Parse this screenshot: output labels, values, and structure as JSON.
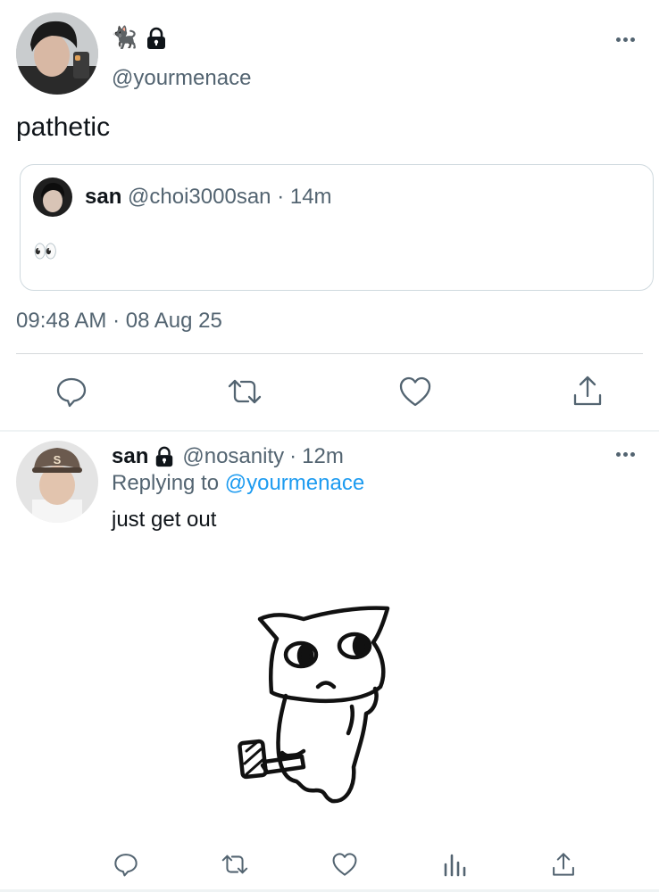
{
  "main_tweet": {
    "name_emoji": "🐈‍⬛",
    "handle": "@yourmenace",
    "text": "pathetic",
    "timestamp": "09:48 AM · 08 Aug 25"
  },
  "quoted_tweet": {
    "name": "san",
    "handle": "@choi3000san",
    "separator": "·",
    "time": "14m",
    "text": "👀"
  },
  "actions": [
    "reply-icon",
    "retweet-icon",
    "like-icon",
    "share-icon"
  ],
  "reply_tweet": {
    "name": "san",
    "handle": "@nosanity",
    "separator": "·",
    "time": "12m",
    "replying_prefix": "Replying to",
    "replying_handle": "@yourmenace",
    "text": "just get out"
  },
  "reply_actions": [
    "reply-icon",
    "retweet-icon",
    "like-icon",
    "analytics-icon",
    "share-icon"
  ],
  "colors": {
    "text": "#0f1419",
    "secondary": "#536471",
    "link": "#1d9bf0",
    "border": "#cfd9de"
  }
}
